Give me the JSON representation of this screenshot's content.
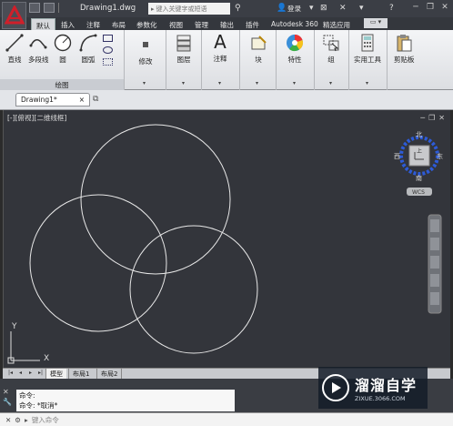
{
  "titlebar": {
    "doc_title": "Drawing1.dwg",
    "search_placeholder": "键入关键字或短语",
    "login": "登录"
  },
  "tabs": [
    "默认",
    "插入",
    "注释",
    "布局",
    "参数化",
    "视图",
    "管理",
    "输出",
    "插件",
    "Autodesk 360",
    "精选应用"
  ],
  "ribbon": {
    "draw": {
      "line": "直线",
      "polyline": "多段线",
      "circle": "圆",
      "arc": "圆弧",
      "caption": "绘图"
    },
    "modify": "修改",
    "layers": "图层",
    "annotation": "注释",
    "block": "块",
    "properties": "特性",
    "groups": "组",
    "utilities": "实用工具",
    "clipboard": "剪贴板"
  },
  "doc_tab": {
    "label": "Drawing1*",
    "close": "×"
  },
  "viewport": {
    "label": "[-][俯视][二维线框]",
    "viewcube_top": "上",
    "north": "北",
    "south": "南",
    "east": "东",
    "west": "西",
    "wcs": "WCS"
  },
  "ucs": {
    "x": "X",
    "y": "Y"
  },
  "layout_tabs": [
    "模型",
    "布局1",
    "布局2"
  ],
  "command": {
    "history": [
      "命令:",
      "命令: *取消*"
    ],
    "input_placeholder": "键入命令"
  },
  "watermark": {
    "title": "溜溜自学",
    "url": "ZIXUE.3066.COM"
  },
  "colors": {
    "canvas": "#33353b",
    "ribbon": "#e8e9ec",
    "titlebar": "#3b3e45",
    "accent": "#c0202a"
  }
}
